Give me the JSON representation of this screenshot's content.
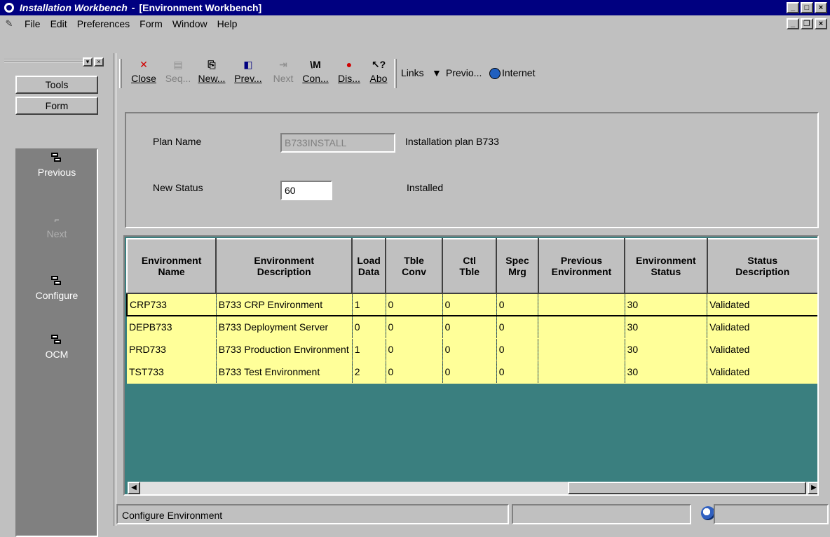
{
  "window": {
    "app_title": "Installation Workbench",
    "separator": "-",
    "doc_title": "[Environment Workbench]"
  },
  "menu": {
    "items": [
      "File",
      "Edit",
      "Preferences",
      "Form",
      "Window",
      "Help"
    ]
  },
  "left_panel": {
    "tabs": [
      "Tools",
      "Form"
    ],
    "items": [
      {
        "label": "Previous",
        "icon": "form-icon",
        "enabled": true
      },
      {
        "label": "Next",
        "icon": "next-icon",
        "enabled": false
      },
      {
        "label": "Configure",
        "icon": "form-icon",
        "enabled": true
      },
      {
        "label": "OCM",
        "icon": "form-icon",
        "enabled": true
      }
    ]
  },
  "toolbar": {
    "buttons": [
      {
        "label": "Close",
        "icon": "close-x-icon",
        "enabled": true
      },
      {
        "label": "Seq...",
        "icon": "sequence-icon",
        "enabled": false
      },
      {
        "label": "New...",
        "icon": "new-icon",
        "enabled": true
      },
      {
        "label": "Prev...",
        "icon": "prev-icon",
        "enabled": true
      },
      {
        "label": "Next",
        "icon": "next-icon",
        "enabled": false
      },
      {
        "label": "Con...",
        "icon": "configure-icon",
        "enabled": true
      },
      {
        "label": "Dis...",
        "icon": "display-icon",
        "enabled": true
      },
      {
        "label": "Abo",
        "icon": "about-icon",
        "enabled": true
      }
    ],
    "links_label": "Links",
    "previous_link": "Previo...",
    "internet_link": "Internet"
  },
  "header": {
    "plan_name_label": "Plan Name",
    "plan_name_value": "B733INSTALL",
    "plan_description": "Installation plan B733",
    "new_status_label": "New Status",
    "new_status_value": "60",
    "new_status_description": "Installed"
  },
  "grid": {
    "columns": [
      "Environment\nName",
      "Environment\nDescription",
      "Load\nData",
      "Tble\nConv",
      "Ctl\nTble",
      "Spec\nMrg",
      "Previous\nEnvironment",
      "Environment\nStatus",
      "Status\nDescription"
    ],
    "rows": [
      [
        "CRP733",
        "B733 CRP Environment",
        "1",
        "0",
        "0",
        "0",
        "",
        "30",
        "Validated"
      ],
      [
        "DEPB733",
        "B733 Deployment Server",
        "0",
        "0",
        "0",
        "0",
        "",
        "30",
        "Validated"
      ],
      [
        "PRD733",
        "B733 Production Environment",
        "1",
        "0",
        "0",
        "0",
        "",
        "30",
        "Validated"
      ],
      [
        "TST733",
        "B733 Test Environment",
        "2",
        "0",
        "0",
        "0",
        "",
        "30",
        "Validated"
      ]
    ],
    "selected_row": 0
  },
  "status_bar": {
    "message": "Configure Environment"
  },
  "colors": {
    "title_bar": "#000080",
    "grid_row": "#ffff99",
    "grid_empty": "#3a7f7f"
  }
}
